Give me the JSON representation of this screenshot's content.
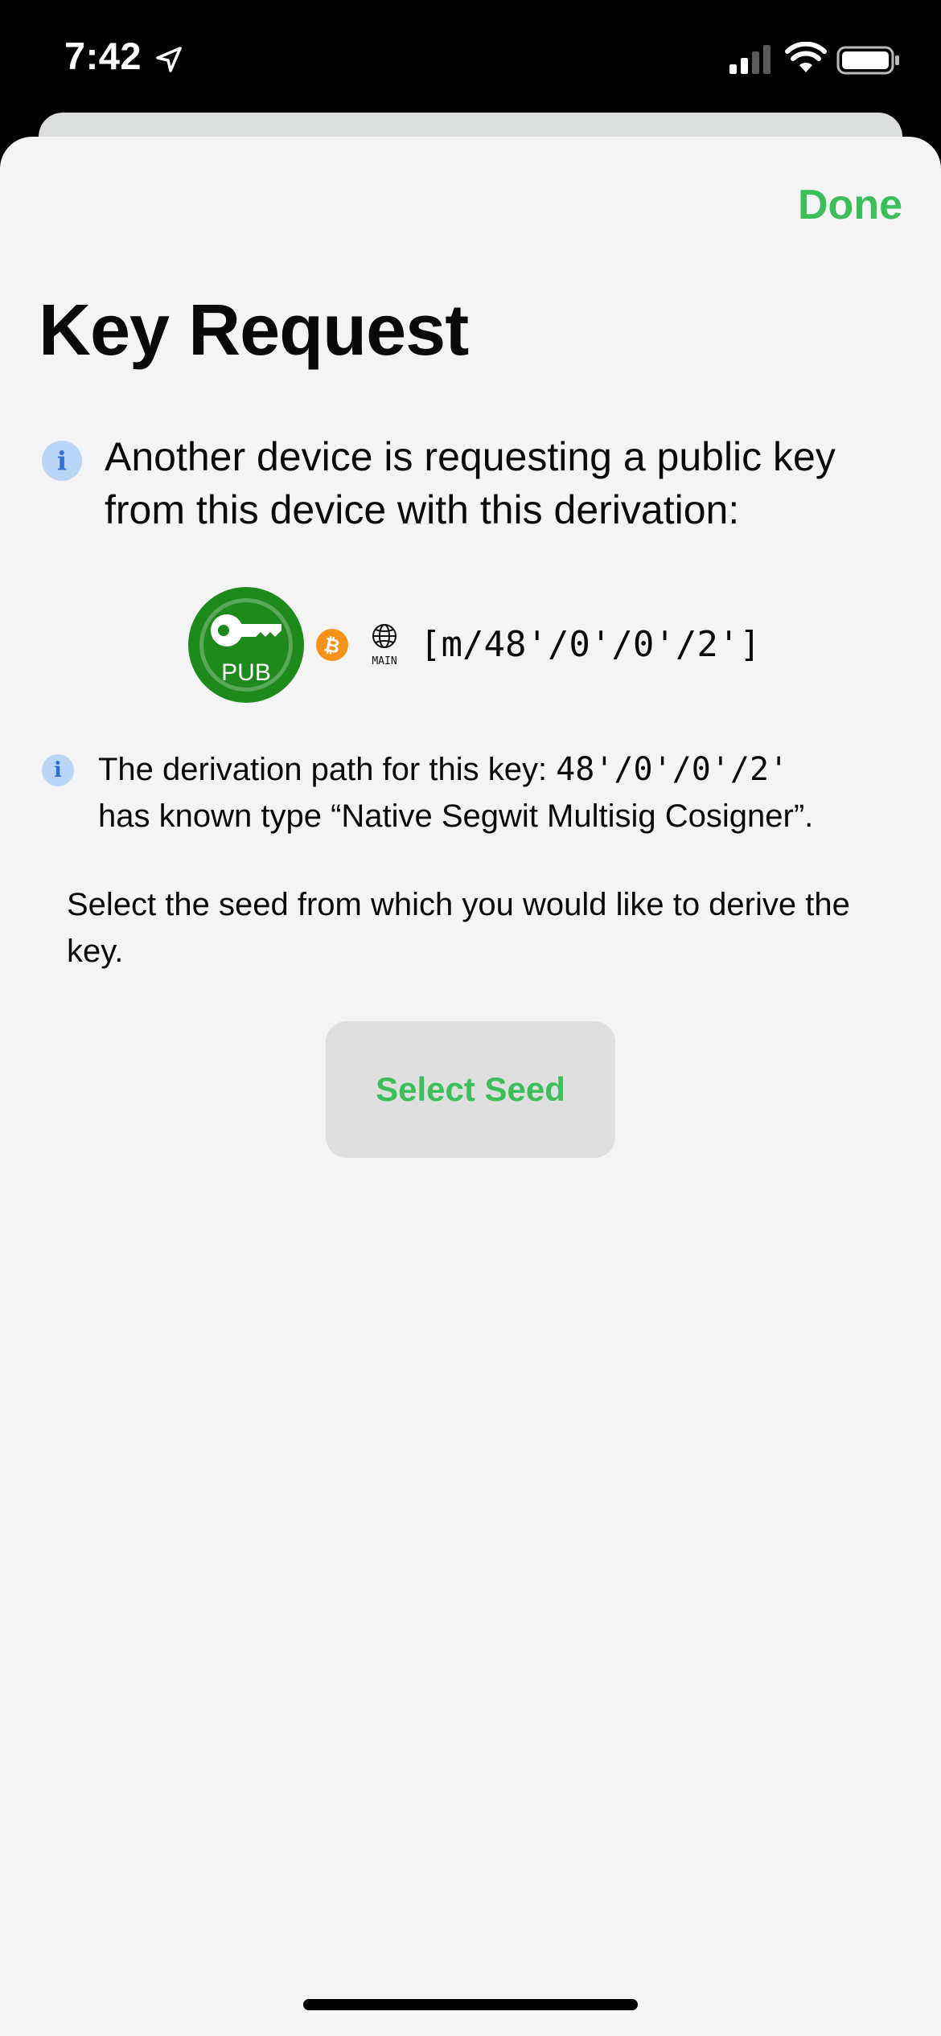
{
  "status_bar": {
    "time": "7:42",
    "icons": [
      "location-arrow-icon",
      "cellular-signal-icon",
      "wifi-icon",
      "battery-icon"
    ]
  },
  "header": {
    "done_label": "Done"
  },
  "page": {
    "title": "Key Request",
    "request_text": "Another device is requesting a public key from this device with this derivation:"
  },
  "key": {
    "badge_label": "PUB",
    "network_label": "MAIN",
    "path": "[m/48'/0'/0'/2']",
    "icons": [
      "public-key-icon",
      "bitcoin-icon",
      "network-globe-icon"
    ]
  },
  "derivation_info": {
    "prefix": "The derivation path for this key: ",
    "path": "48'/0'/0'/2'",
    "suffix": "has known type “Native Segwit Multisig Cosigner”."
  },
  "seed_selection": {
    "prompt": "Select the seed from which you would like to derive the key.",
    "button_label": "Select Seed"
  },
  "colors": {
    "accent": "#3cbf5b",
    "info_icon_bg": "#b9d6f6",
    "sheet_bg": "#f3f4f3",
    "pub_key_green": "#1e8a1e",
    "bitcoin_orange": "#f7931a"
  }
}
